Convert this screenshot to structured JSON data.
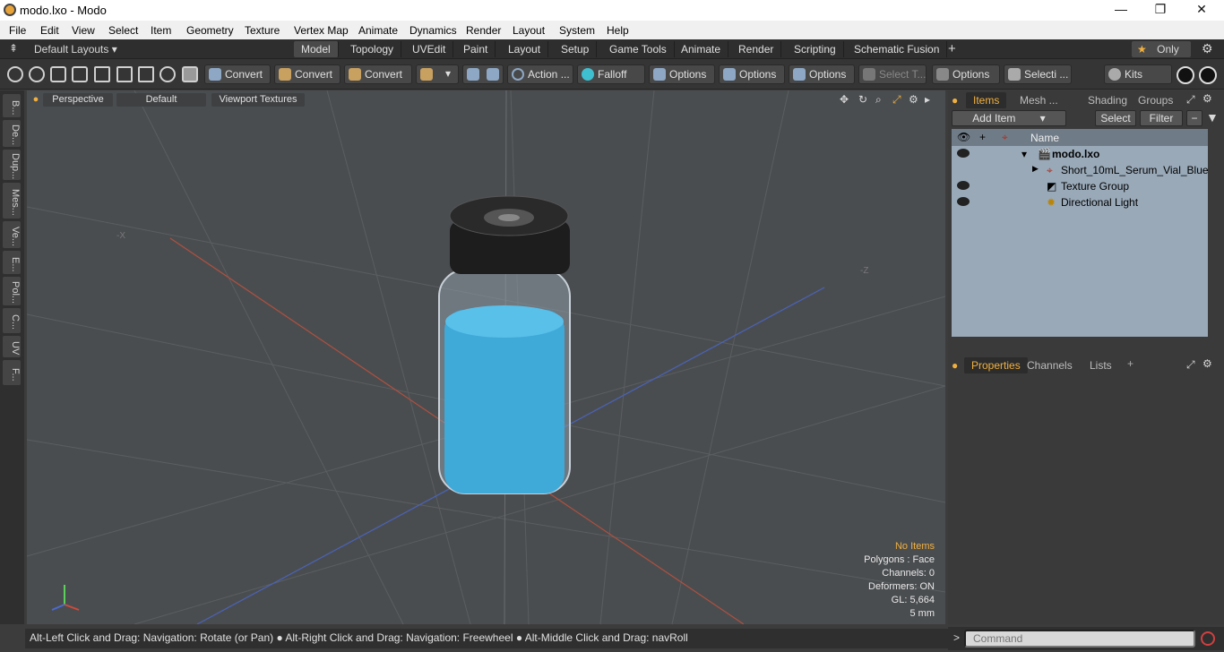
{
  "window": {
    "title": "modo.lxo - Modo",
    "minimize": "—",
    "restore": "❐",
    "close": "✕"
  },
  "menu": [
    "File",
    "Edit",
    "View",
    "Select",
    "Item",
    "Geometry",
    "Texture",
    "Vertex Map",
    "Animate",
    "Dynamics",
    "Render",
    "Layout",
    "System",
    "Help"
  ],
  "layouts": {
    "label": "Default Layouts ▾",
    "only": "Only",
    "star": "★",
    "add": "+",
    "gear": "⚙"
  },
  "tabs": [
    "Model",
    "Topology",
    "UVEdit",
    "Paint",
    "Layout",
    "Setup",
    "Game Tools",
    "Animate",
    "Render",
    "Scripting",
    "Schematic Fusion"
  ],
  "toolbar": {
    "convert1": "Convert",
    "convert2": "Convert",
    "convert3": "Convert",
    "action": "Action",
    "action_more": "...",
    "falloff": "Falloff",
    "options1": "Options",
    "options2": "Options",
    "options3": "Options",
    "select_t": "Select T...",
    "options4": "Options",
    "selecti": "Selecti ...",
    "kits": "Kits"
  },
  "left_tabs": [
    "B...",
    "De...",
    "Dup...",
    "Mes...",
    "Ve...",
    "E...",
    "Pol...",
    "C...",
    "UV",
    "F..."
  ],
  "viewport": {
    "perspective": "Perspective",
    "default": "Default",
    "textures": "Viewport Textures",
    "axis_neg_x": "-X",
    "axis_neg_z": "-Z",
    "info": {
      "no_items": "No Items",
      "polygons": "Polygons : Face",
      "channels": "Channels: 0",
      "deformers": "Deformers: ON",
      "gl": "GL: 5,664",
      "scale": "5 mm"
    }
  },
  "status": "Alt-Left Click and Drag: Navigation: Rotate (or Pan) ● Alt-Right Click and Drag: Navigation: Freewheel ● Alt-Middle Click and Drag: navRoll",
  "items_panel": {
    "tabs": [
      "Items",
      "Mesh ...",
      "Shading",
      "Groups"
    ],
    "add_item": "Add Item",
    "select": "Select",
    "filter": "Filter",
    "col_name": "Name",
    "rows": [
      {
        "label": "modo.lxo",
        "bold": true
      },
      {
        "label": "Short_10mL_Serum_Vial_Blue"
      },
      {
        "label": "Texture Group"
      },
      {
        "label": "Directional Light"
      }
    ]
  },
  "props_panel": {
    "tabs": [
      "Properties",
      "Channels",
      "Lists"
    ],
    "add": "+"
  },
  "command": {
    "placeholder": "Command",
    "prompt": ">"
  }
}
